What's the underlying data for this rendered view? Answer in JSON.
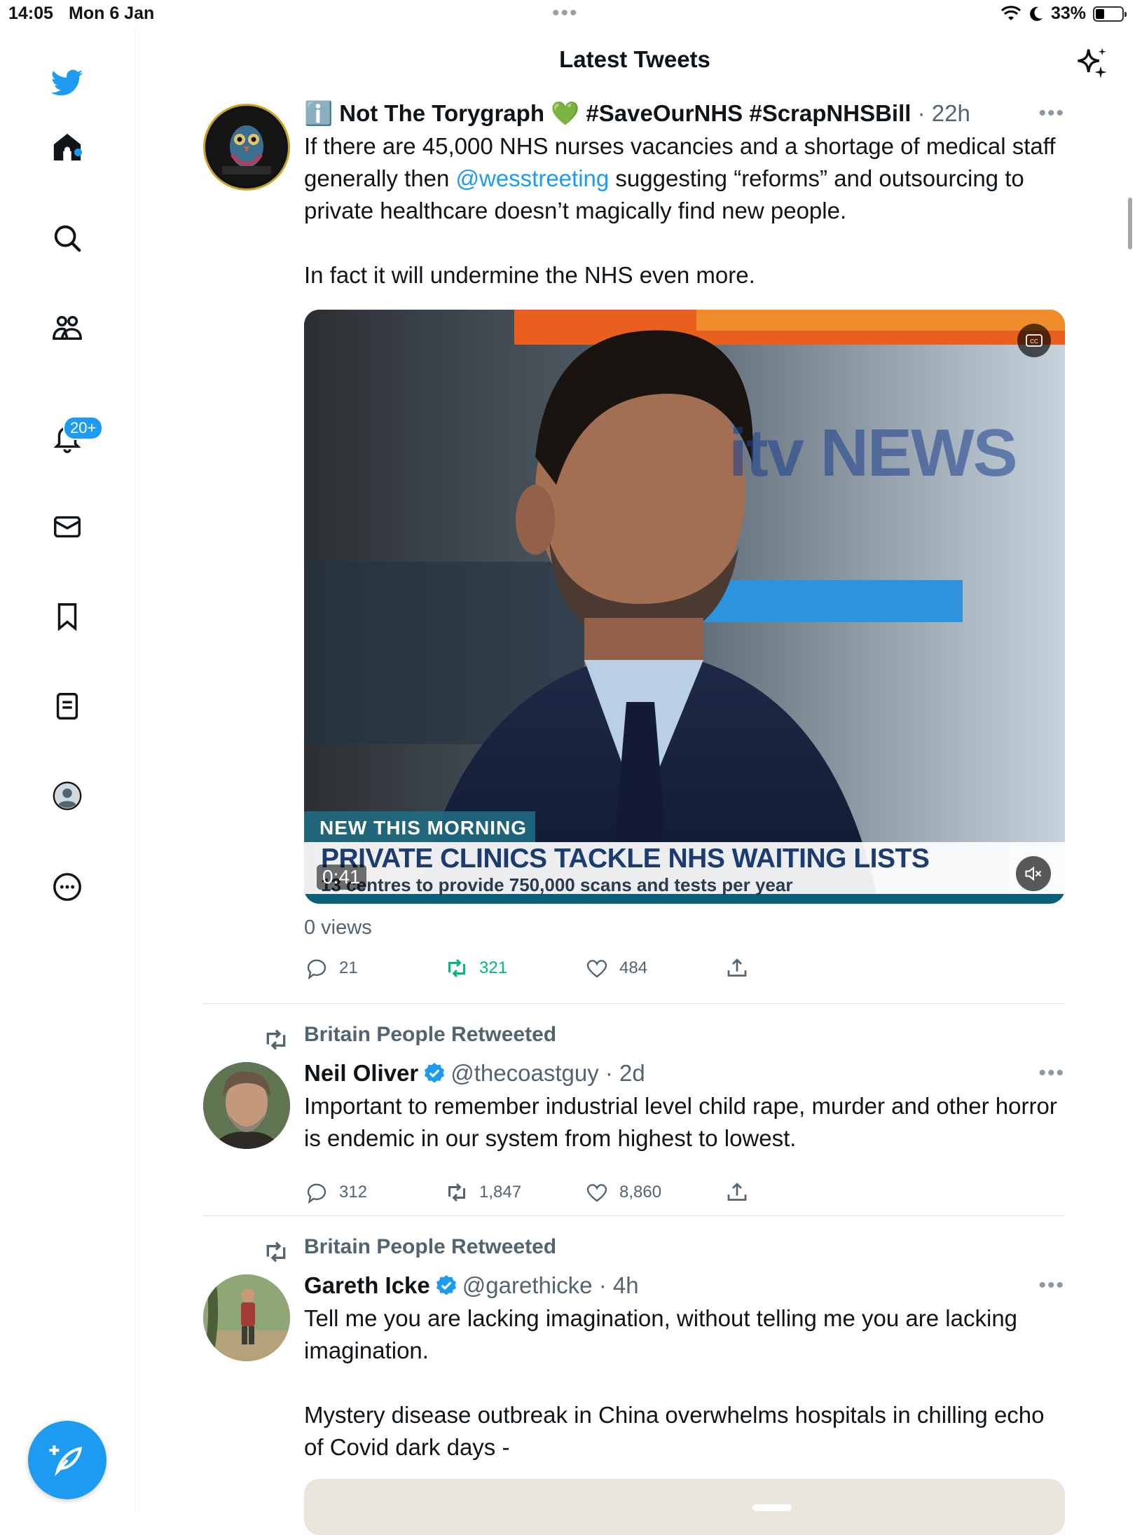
{
  "status_bar": {
    "time": "14:05",
    "date": "Mon 6 Jan",
    "battery": "33%",
    "battery_level": 0.33
  },
  "header": {
    "title": "Latest Tweets"
  },
  "sidebar": {
    "items": [
      {
        "icon": "home-icon"
      },
      {
        "icon": "search-icon"
      },
      {
        "icon": "communities-icon"
      },
      {
        "icon": "bell-icon"
      },
      {
        "icon": "mail-icon"
      },
      {
        "icon": "bookmark-icon"
      },
      {
        "icon": "lists-icon"
      },
      {
        "icon": "profile-icon"
      },
      {
        "icon": "more-circle-icon"
      }
    ],
    "notifications_badge": "20+"
  },
  "tweets": [
    {
      "emoji": "ℹ️",
      "name": "Not The Torygraph 💚 #SaveOurNHS #ScrapNHSBill",
      "time": "· 22h",
      "text_before": "If there are 45,000 NHS nurses vacancies and a shortage of medical staff generally then ",
      "mention": "@wesstreeting",
      "text_after": " suggesting “reforms” and outsourcing to private healthcare doesn’t magically find new people.\n\nIn fact it will undermine the NHS even more.",
      "video": {
        "banner_top": "NEW THIS MORNING",
        "headline": "PRIVATE CLINICS TACKLE NHS WAITING LISTS",
        "subline": "13 centres to provide 750,000 scans and tests per year",
        "logo": "itv NEWS",
        "duration": "0:41"
      },
      "views": "0 views",
      "replies": "21",
      "retweets": "321",
      "likes": "484"
    },
    {
      "retweeted_by": "Britain People Retweeted",
      "name": "Neil Oliver",
      "handle": "@thecoastguy",
      "time": "· 2d",
      "text": "Important to remember industrial level child rape, murder and other horror is endemic in our system from highest to lowest.",
      "replies": "312",
      "retweets": "1,847",
      "likes": "8,860"
    },
    {
      "retweeted_by": "Britain People Retweeted",
      "name": "Gareth Icke",
      "handle": "@garethicke",
      "time": "· 4h",
      "text": "Tell me you are lacking imagination, without telling me you are lacking imagination.\n\nMystery disease outbreak in China overwhelms hospitals in chilling echo of Covid dark days -"
    }
  ],
  "colors": {
    "accent": "#1d9bf0",
    "retweet_green": "#00ba7c",
    "muted": "#536471"
  }
}
